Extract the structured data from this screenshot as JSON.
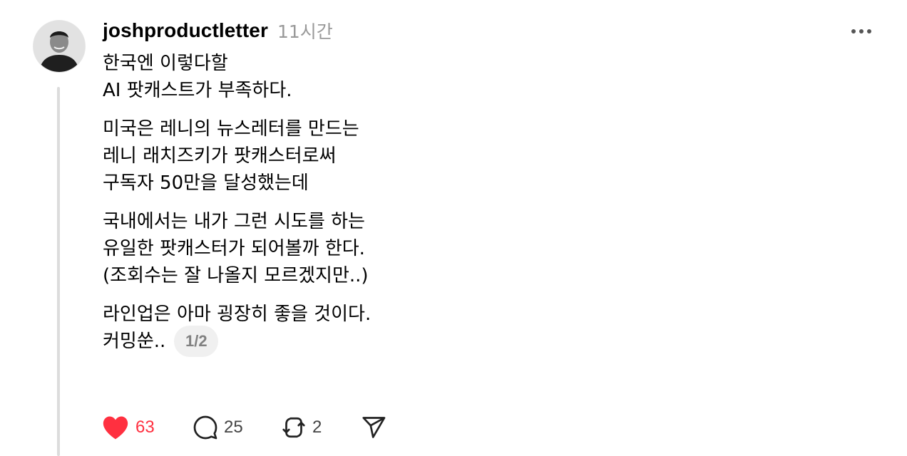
{
  "post": {
    "username": "joshproductletter",
    "time": "11시간",
    "lines": [
      "한국엔 이렇다할",
      "AI 팟캐스트가 부족하다.",
      "미국은 레니의 뉴스레터를 만드는",
      "레니 래치즈키가 팟캐스터로써",
      "구독자 50만을 달성했는데",
      "국내에서는 내가 그런 시도를 하는",
      "유일한 팟캐스터가 되어볼까 한다.",
      "(조회수는 잘 나올지 모르겠지만..)",
      "라인업은 아마 굉장히 좋을 것이다.",
      "커밍쑨.."
    ],
    "page_indicator": "1/2"
  },
  "actions": {
    "likes": "63",
    "replies": "25",
    "reposts": "2"
  },
  "icons": {
    "more": "more-horizontal-icon",
    "like": "heart-filled-icon",
    "reply": "comment-bubble-icon",
    "repost": "repost-icon",
    "share": "send-icon"
  },
  "colors": {
    "like": "#ff3040",
    "muted": "#999999",
    "thread_line": "#dcdcdc"
  }
}
